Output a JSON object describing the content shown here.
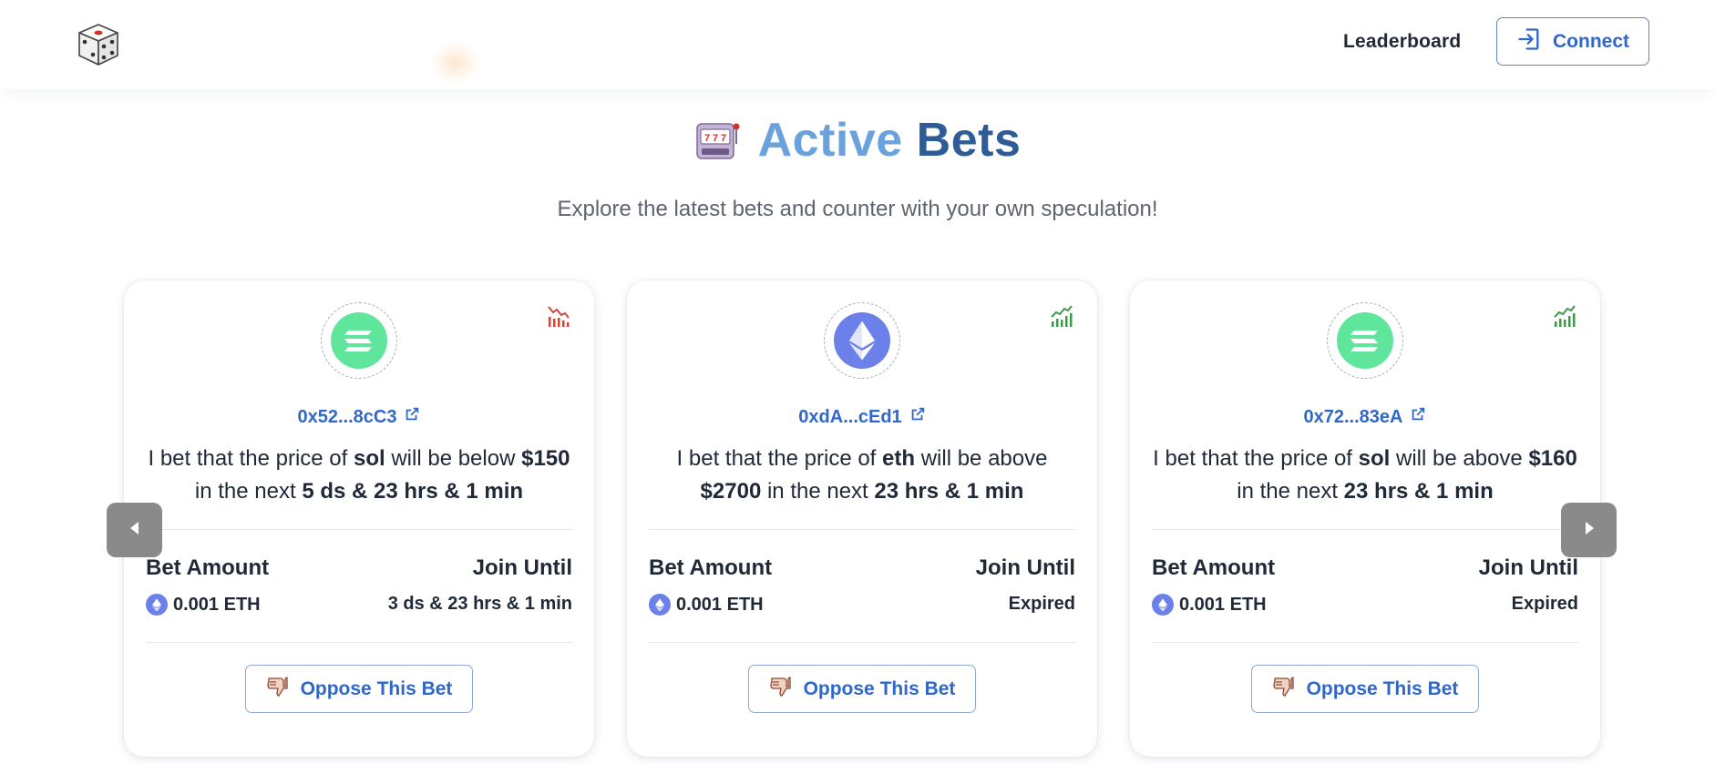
{
  "header": {
    "logo_icon": "dice-icon",
    "nav": {
      "leaderboard": "Leaderboard"
    },
    "connect": {
      "label": "Connect",
      "icon": "login-icon"
    }
  },
  "hero": {
    "icon": "slot-machine-icon",
    "title_word1": "Active",
    "title_word2": "Bets",
    "subtitle": "Explore the latest bets and counter with your own speculation!"
  },
  "colors": {
    "accent_blue": "#2f68c9",
    "title_light": "#6aa2dd",
    "title_dark": "#2d5c97",
    "trend_down": "#d0463b",
    "trend_up": "#3f9a4b",
    "sol_green": "#5fe59c",
    "eth_purple": "#6b80e8"
  },
  "labels": {
    "bet_amount": "Bet Amount",
    "join_until": "Join Until",
    "oppose": "Oppose This Bet"
  },
  "bets": [
    {
      "coin_icon": "solana-icon",
      "trend_icon": "trend-down-icon",
      "address": "0x52...8cC3",
      "text_prefix": "I bet that the price of",
      "asset": "sol",
      "text_mid": "will be below",
      "target": "$150",
      "text_in": "in the next",
      "duration": "5 ds & 23 hrs & 1 min",
      "amount": "0.001 ETH",
      "join_until": "3 ds & 23 hrs & 1 min"
    },
    {
      "coin_icon": "ethereum-icon",
      "trend_icon": "trend-up-icon",
      "address": "0xdA...cEd1",
      "text_prefix": "I bet that the price of",
      "asset": "eth",
      "text_mid": "will be above",
      "target": "$2700",
      "text_in": "in the next",
      "duration": "23 hrs & 1 min",
      "amount": "0.001 ETH",
      "join_until": "Expired"
    },
    {
      "coin_icon": "solana-icon",
      "trend_icon": "trend-up-icon",
      "address": "0x72...83eA",
      "text_prefix": "I bet that the price of",
      "asset": "sol",
      "text_mid": "will be above",
      "target": "$160",
      "text_in": "in the next",
      "duration": "23 hrs & 1 min",
      "amount": "0.001 ETH",
      "join_until": "Expired"
    }
  ],
  "carousel": {
    "prev_icon": "arrow-left-icon",
    "next_icon": "arrow-right-icon"
  }
}
